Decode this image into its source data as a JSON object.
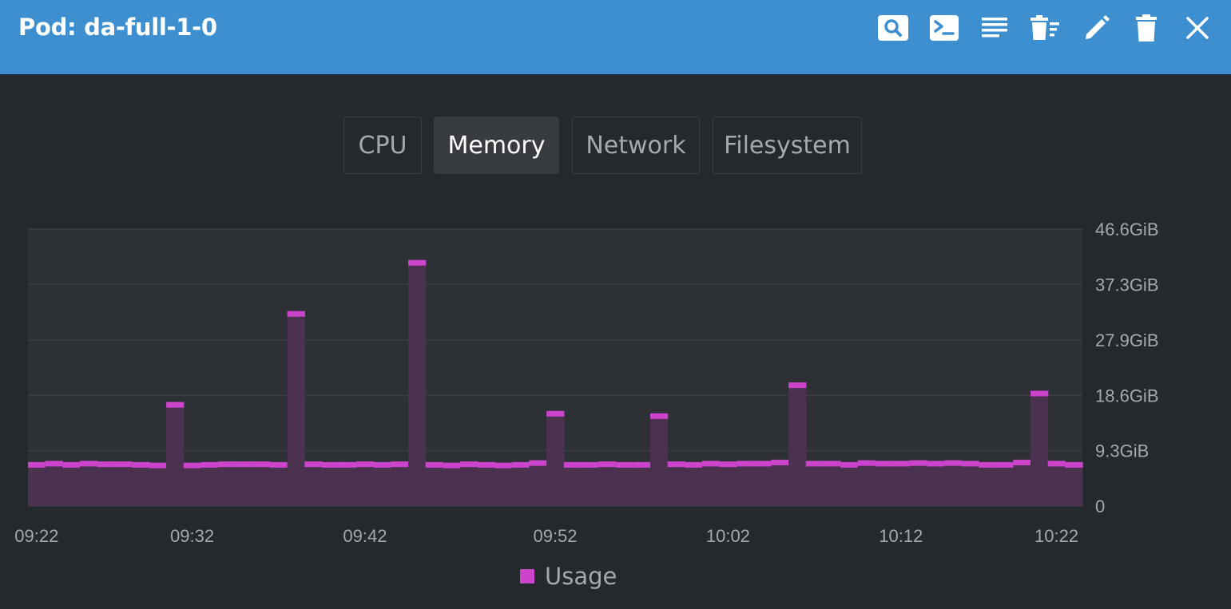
{
  "header": {
    "title": "Pod: da-full-1-0",
    "icons": [
      "search-icon",
      "terminal-icon",
      "logs-icon",
      "delete-list-icon",
      "edit-icon",
      "trash-icon",
      "close-icon"
    ]
  },
  "tabs": [
    {
      "label": "CPU",
      "active": false
    },
    {
      "label": "Memory",
      "active": true
    },
    {
      "label": "Network",
      "active": false
    },
    {
      "label": "Filesystem",
      "active": false
    }
  ],
  "colors": {
    "header": "#3d8fd0",
    "background": "#25282c",
    "series": "#cc44cc",
    "area": "#4a3150"
  },
  "chart_data": {
    "type": "bar",
    "title": "",
    "ylabel": "",
    "xlabel": "",
    "y_unit": "GiB",
    "ylim": [
      0,
      46.6
    ],
    "y_ticks": [
      {
        "value": 0,
        "label": "0"
      },
      {
        "value": 9.3,
        "label": "9.3GiB"
      },
      {
        "value": 18.6,
        "label": "18.6GiB"
      },
      {
        "value": 27.9,
        "label": "27.9GiB"
      },
      {
        "value": 37.3,
        "label": "37.3GiB"
      },
      {
        "value": 46.6,
        "label": "46.6GiB"
      }
    ],
    "x_ticks": [
      {
        "index": 0,
        "label": "09:22"
      },
      {
        "index": 9,
        "label": "09:32"
      },
      {
        "index": 19,
        "label": "09:42"
      },
      {
        "index": 30,
        "label": "09:52"
      },
      {
        "index": 40,
        "label": "10:02"
      },
      {
        "index": 50,
        "label": "10:12"
      },
      {
        "index": 59,
        "label": "10:22"
      }
    ],
    "grid": true,
    "legend_position": "bottom-center",
    "series": [
      {
        "name": "Usage",
        "values": [
          7.4,
          7.6,
          7.4,
          7.6,
          7.5,
          7.5,
          7.4,
          7.3,
          17.5,
          7.3,
          7.4,
          7.5,
          7.5,
          7.5,
          7.4,
          32.8,
          7.5,
          7.4,
          7.4,
          7.5,
          7.4,
          7.5,
          41.4,
          7.4,
          7.3,
          7.5,
          7.4,
          7.3,
          7.4,
          7.7,
          16.0,
          7.4,
          7.4,
          7.5,
          7.4,
          7.4,
          15.6,
          7.5,
          7.4,
          7.6,
          7.5,
          7.6,
          7.6,
          7.8,
          20.8,
          7.6,
          7.6,
          7.4,
          7.7,
          7.6,
          7.6,
          7.7,
          7.6,
          7.7,
          7.6,
          7.4,
          7.4,
          7.8,
          19.4,
          7.6,
          7.4
        ]
      }
    ]
  }
}
